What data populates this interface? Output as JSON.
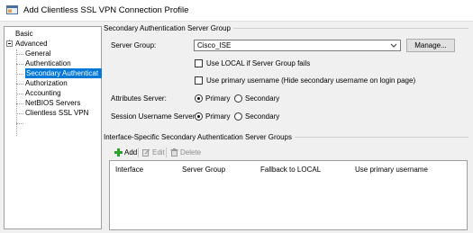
{
  "window": {
    "title": "Add Clientless SSL VPN Connection Profile"
  },
  "tree": {
    "items": [
      {
        "label": "Basic"
      },
      {
        "label": "Advanced"
      },
      {
        "label": "General"
      },
      {
        "label": "Authentication"
      },
      {
        "label": "Secondary Authenticat"
      },
      {
        "label": "Authorization"
      },
      {
        "label": "Accounting"
      },
      {
        "label": "NetBIOS Servers"
      },
      {
        "label": "Clientless SSL VPN"
      }
    ]
  },
  "secondary_auth": {
    "group_title": "Secondary Authentication Server Group",
    "server_group_label": "Server Group:",
    "server_group_value": "Cisco_ISE",
    "manage_label": "Manage...",
    "use_local_label": "Use LOCAL if Server Group fails",
    "use_primary_username_label": "Use primary username (Hide secondary username on login page)",
    "attributes_server_label": "Attributes Server:",
    "session_username_server_label": "Session Username Server:",
    "primary_label": "Primary",
    "secondary_label": "Secondary"
  },
  "interface_groups": {
    "group_title": "Interface-Specific Secondary Authentication Server Groups",
    "toolbar": {
      "add": "Add",
      "edit": "Edit",
      "delete": "Delete"
    },
    "columns": [
      "Interface",
      "Server Group",
      "Fallback to LOCAL",
      "Use primary username"
    ]
  },
  "colors": {
    "selection": "#0078d7",
    "add_icon": "#2e9e2e"
  }
}
